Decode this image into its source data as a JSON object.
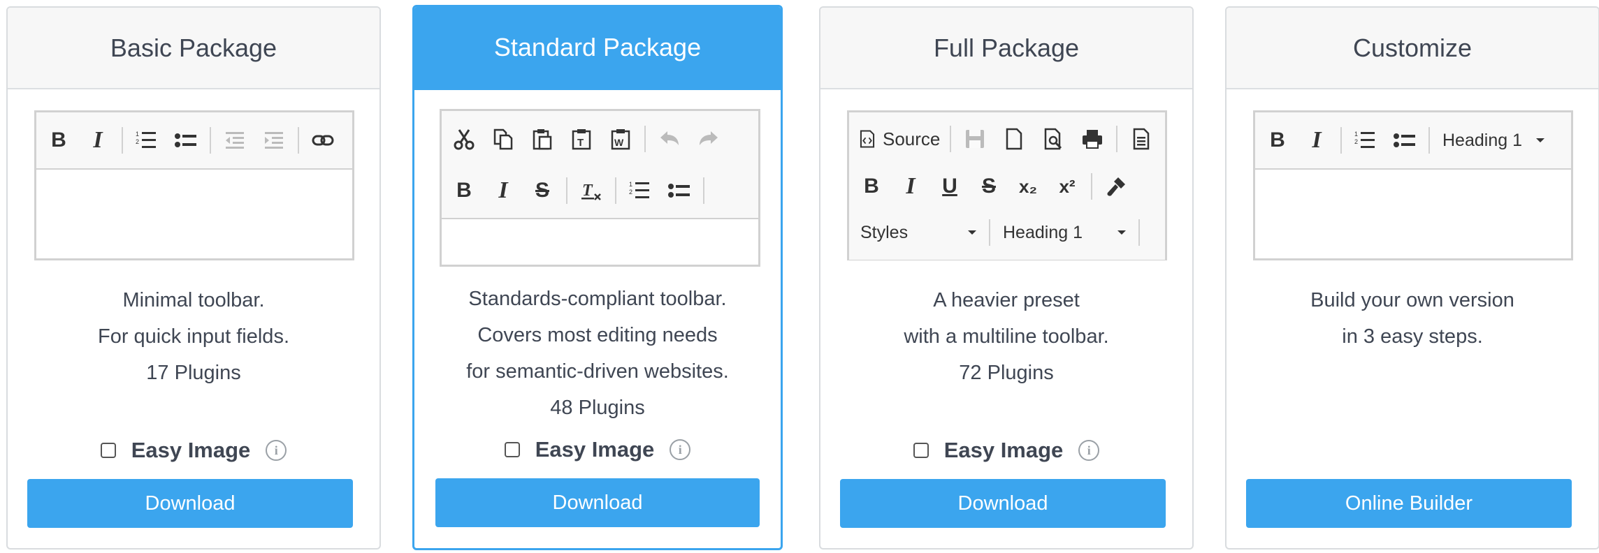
{
  "cards": [
    {
      "title": "Basic Package",
      "description": [
        "Minimal toolbar.",
        "For quick input fields.",
        "17 Plugins"
      ],
      "easy_image_label": "Easy Image",
      "button_label": "Download"
    },
    {
      "title": "Standard Package",
      "description": [
        "Standards-compliant toolbar.",
        "Covers most editing needs",
        "for semantic-driven websites.",
        "48 Plugins"
      ],
      "easy_image_label": "Easy Image",
      "button_label": "Download"
    },
    {
      "title": "Full Package",
      "description": [
        "A heavier preset",
        "with a multiline toolbar.",
        "72 Plugins"
      ],
      "easy_image_label": "Easy Image",
      "button_label": "Download",
      "toolbar": {
        "source_label": "Source",
        "styles_label": "Styles",
        "format_label": "Heading 1"
      }
    },
    {
      "title": "Customize",
      "description": [
        "Build your own version",
        "in 3 easy steps."
      ],
      "button_label": "Online Builder",
      "toolbar": {
        "format_label": "Heading 1"
      }
    }
  ],
  "colors": {
    "accent": "#3ba5ee",
    "text": "#3f4653",
    "border": "#d9dcdf"
  },
  "icons": {
    "bold": "B",
    "italic": "I",
    "underline": "U",
    "strike": "S",
    "subscript": "x₂",
    "superscript": "x²",
    "info": "i"
  }
}
